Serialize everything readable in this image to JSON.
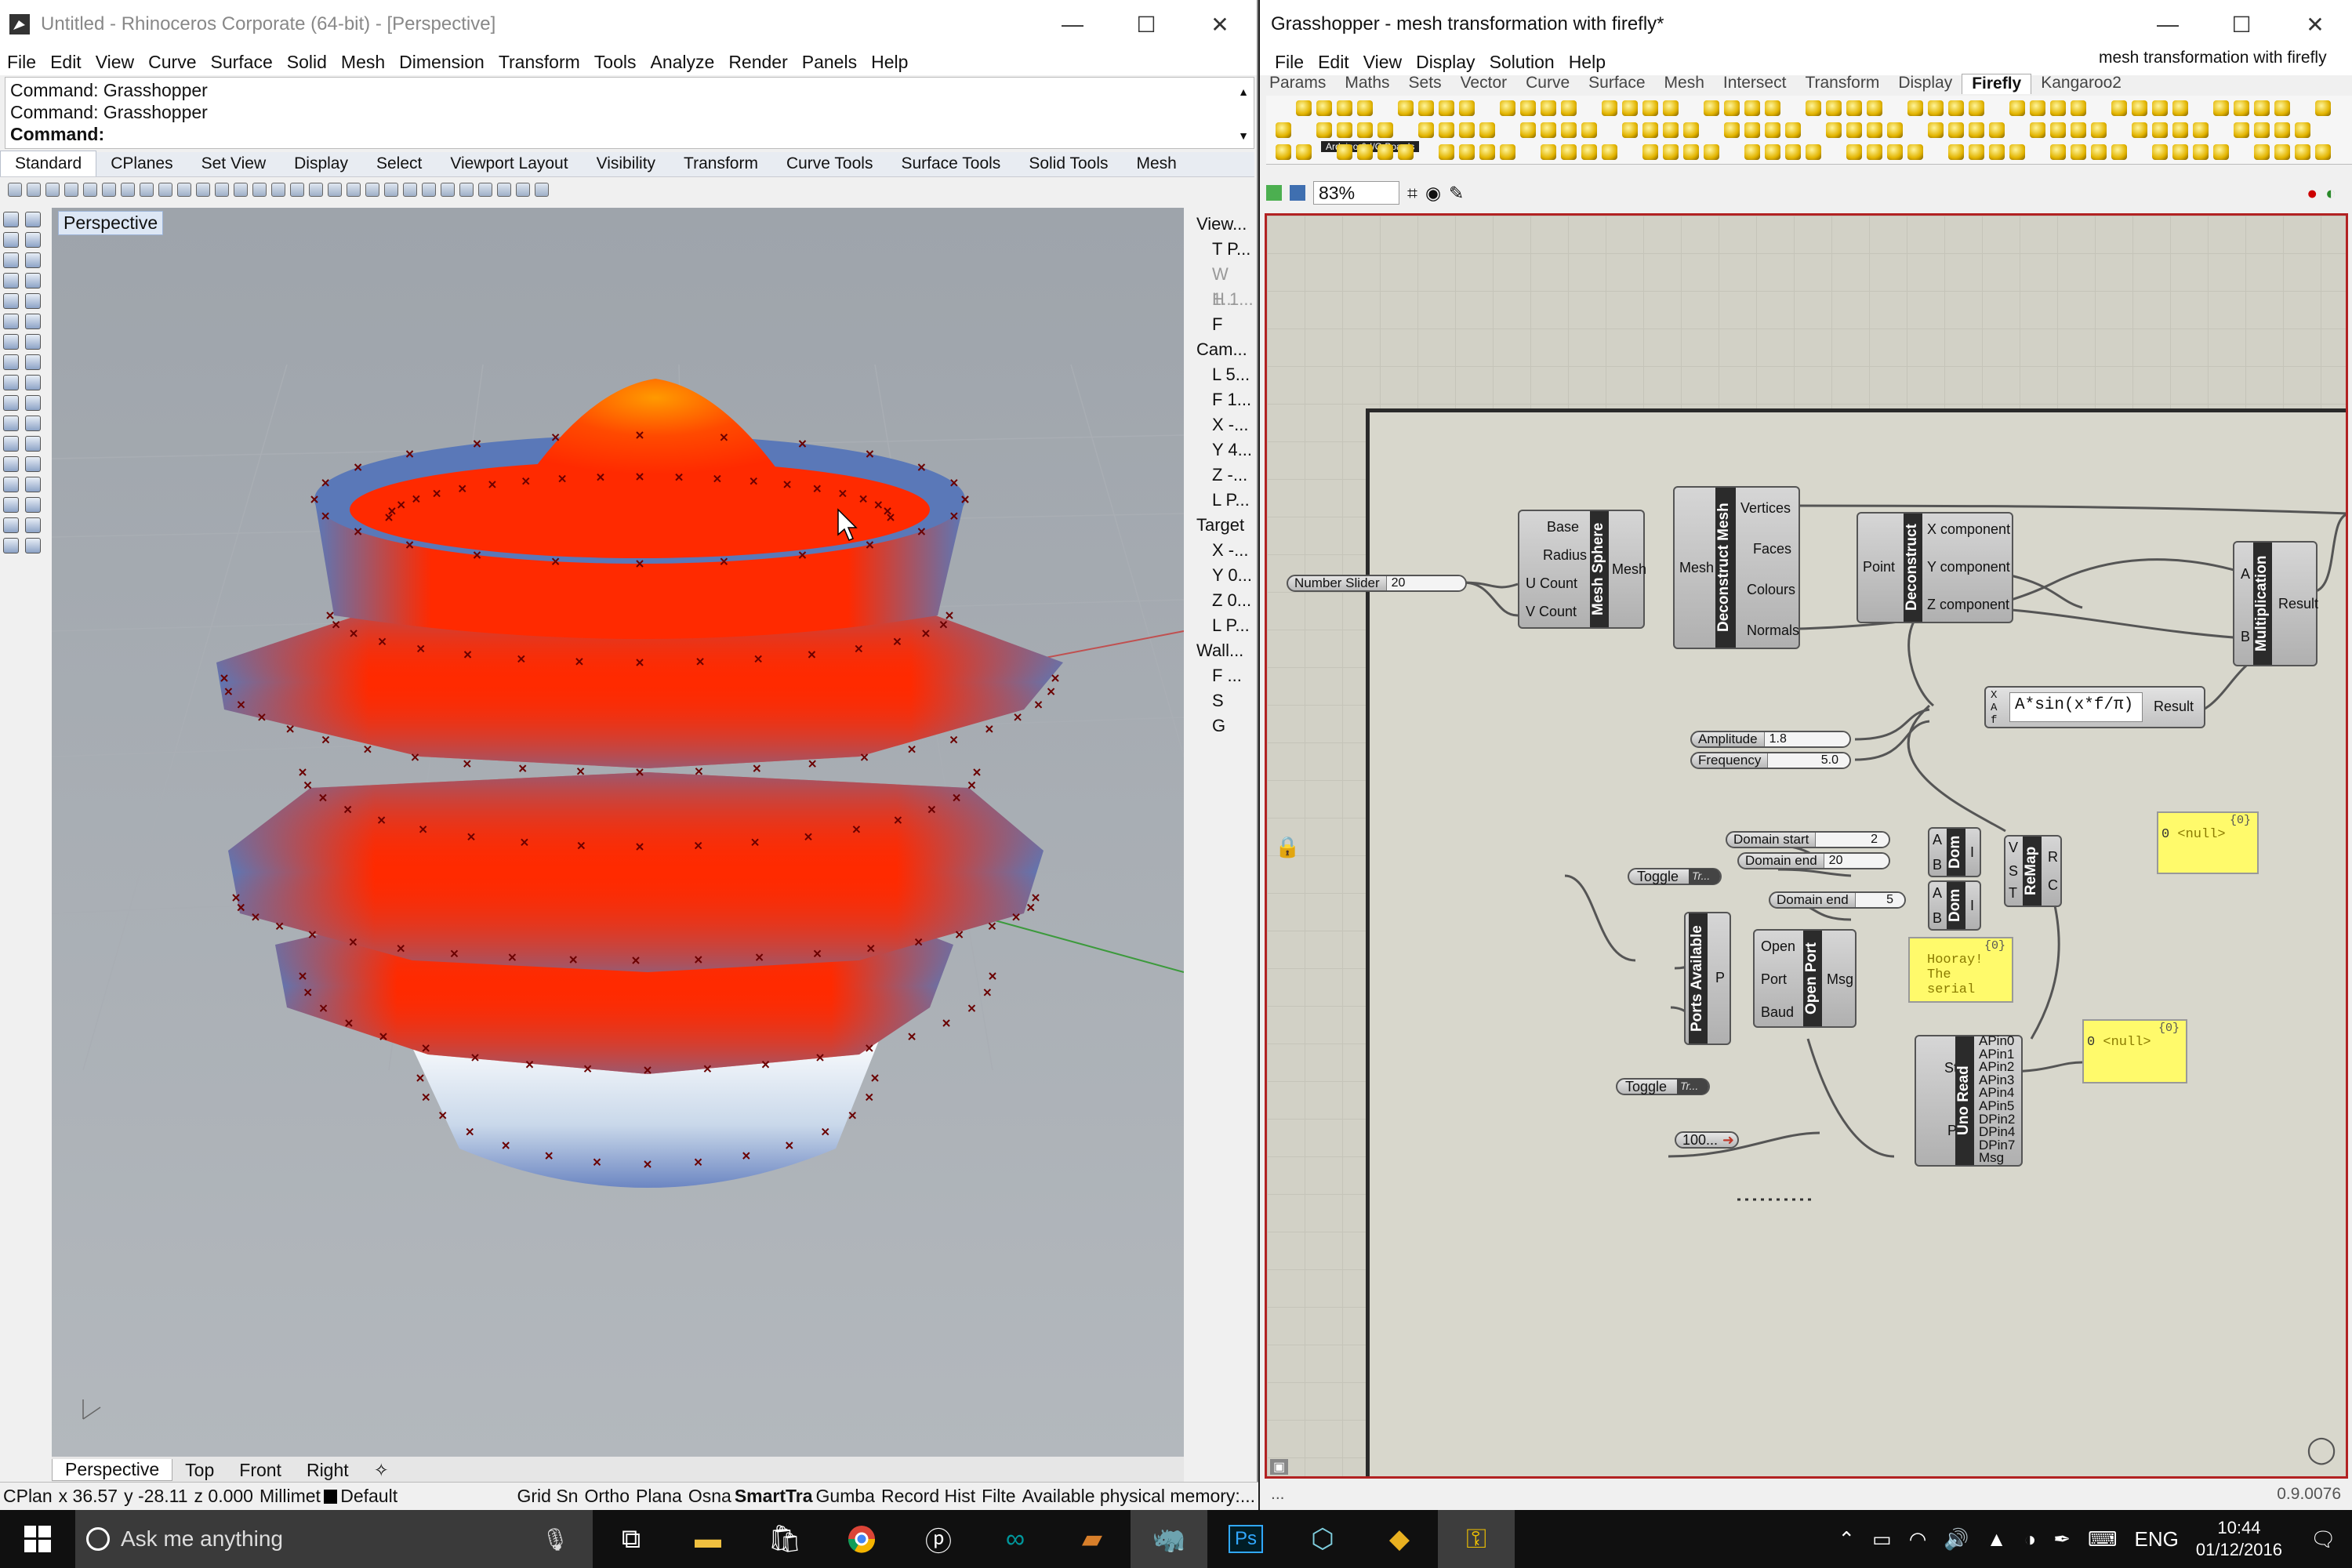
{
  "rhino": {
    "title": "Untitled - Rhinoceros Corporate (64-bit) - [Perspective]",
    "menu": [
      "File",
      "Edit",
      "View",
      "Curve",
      "Surface",
      "Solid",
      "Mesh",
      "Dimension",
      "Transform",
      "Tools",
      "Analyze",
      "Render",
      "Panels",
      "Help"
    ],
    "history": [
      "Command: Grasshopper",
      "Command: Grasshopper"
    ],
    "command_label": "Command:",
    "toolbar_tabs": [
      "Standard",
      "CPlanes",
      "Set View",
      "Display",
      "Select",
      "Viewport Layout",
      "Visibility",
      "Transform",
      "Curve Tools",
      "Surface Tools",
      "Solid Tools",
      "Mesh"
    ],
    "viewport_label": "Perspective",
    "view_tabs": [
      "Perspective",
      "Top",
      "Front",
      "Right"
    ],
    "status": {
      "cplane": "CPlan",
      "x": "x 36.57",
      "y": "y -28.11",
      "z": "z 0.000",
      "units": "Millimet",
      "layer": "Default",
      "toggles": [
        "Grid Sn",
        "Ortho",
        "Plana",
        "Osna",
        "SmartTra",
        "Gumba",
        "Record Hist",
        "Filte"
      ],
      "memory": "Available physical memory:..."
    },
    "properties": {
      "view_header": "View...",
      "view_rows": [
        "T P...",
        "W 1...",
        "H 1...",
        "F"
      ],
      "camera_header": "Cam...",
      "camera_rows": [
        "L 5...",
        "F 1...",
        "X -...",
        "Y 4...",
        "Z -...",
        "L P..."
      ],
      "target_header": "Target",
      "target_rows": [
        "X -...",
        "Y 0...",
        "Z 0...",
        "L P..."
      ],
      "wall_header": "Wall...",
      "wall_rows": [
        "F ...",
        "S",
        "G"
      ]
    }
  },
  "grasshopper": {
    "title": "Grasshopper - mesh transformation with firefly*",
    "menu": [
      "File",
      "Edit",
      "View",
      "Display",
      "Solution",
      "Help"
    ],
    "tabs": [
      "Params",
      "Maths",
      "Sets",
      "Vector",
      "Curve",
      "Surface",
      "Mesh",
      "Intersect",
      "Transform",
      "Display",
      "Firefly",
      "Kangaroo2"
    ],
    "active_tab": "Firefly",
    "doc_name": "mesh transformation with firefly",
    "icon_group_label": "Arduino & I/O Boards",
    "zoom": "83%",
    "version": "0.9.0076",
    "status_left": "...",
    "components": {
      "number_slider": {
        "label": "Number Slider",
        "value": "20"
      },
      "mesh_sphere": {
        "name": "Mesh Sphere",
        "inputs": [
          "Base",
          "Radius",
          "U Count",
          "V Count"
        ],
        "outputs": [
          "Mesh"
        ]
      },
      "deconstruct_mesh": {
        "name": "Deconstruct Mesh",
        "inputs": [
          "Mesh"
        ],
        "outputs": [
          "Vertices",
          "Faces",
          "Colours",
          "Normals"
        ]
      },
      "deconstruct": {
        "name": "Deconstruct",
        "inputs": [
          "Point"
        ],
        "outputs": [
          "X component",
          "Y component",
          "Z component"
        ]
      },
      "multiplication": {
        "name": "Multiplication",
        "inputs": [
          "A",
          "B"
        ],
        "outputs": [
          "Result"
        ]
      },
      "expression": {
        "text": "A*sin(x*f/π)",
        "inputs": [
          "X",
          "A",
          "f"
        ],
        "output": "Result"
      },
      "amplitude": {
        "label": "Amplitude",
        "value": "1.8"
      },
      "frequency": {
        "label": "Frequency",
        "value": "5.0"
      },
      "domain_start": {
        "label": "Domain start",
        "value": "2"
      },
      "domain_end1": {
        "label": "Domain end",
        "value": "20"
      },
      "domain_end2": {
        "label": "Domain end",
        "value": "5"
      },
      "dom1": {
        "name": "Dom",
        "inputs": [
          "A",
          "B"
        ],
        "outputs": [
          "I"
        ]
      },
      "dom2": {
        "name": "Dom",
        "inputs": [
          "A",
          "B"
        ],
        "outputs": [
          "I"
        ]
      },
      "remap": {
        "name": "ReMap",
        "inputs": [
          "V",
          "S",
          "T"
        ],
        "outputs": [
          "R",
          "C"
        ]
      },
      "panel1": {
        "count": "{0}",
        "index": "0",
        "text": "<null>"
      },
      "toggle1": {
        "label": "Toggle",
        "value": "Tr..."
      },
      "ports_available": {
        "name": "Ports Available",
        "outputs": [
          "P"
        ]
      },
      "open_port": {
        "name": "Open Port",
        "inputs": [
          "Open",
          "Port",
          "Baud"
        ],
        "outputs": [
          "Msg"
        ]
      },
      "panel2": {
        "count": "{0}",
        "lines": [
          "Hooray!",
          "The",
          "serial"
        ]
      },
      "uno_read": {
        "name": "Uno Read",
        "inputs": [
          "Start",
          "Port"
        ],
        "outputs": [
          "APin0",
          "APin1",
          "APin2",
          "APin3",
          "APin4",
          "APin5",
          "DPin2",
          "DPin4",
          "DPin7",
          "Msg"
        ]
      },
      "panel3": {
        "count": "{0}",
        "index": "0",
        "text": "<null>"
      },
      "toggle2": {
        "label": "Toggle",
        "value": "Tr..."
      },
      "timer": {
        "label": "100..."
      }
    }
  },
  "taskbar": {
    "search_placeholder": "Ask me anything",
    "apps": [
      "task-view",
      "file-explorer",
      "store",
      "chrome",
      "pinterest",
      "arduino",
      "slate",
      "rhino",
      "photoshop",
      "hexagon",
      "gem",
      "grasshopper-key"
    ],
    "language": "ENG",
    "time": "10:44",
    "date": "01/12/2016"
  },
  "colors": {
    "hot": "#ff2a00",
    "cool": "#5a78b8",
    "canvas": "#d2d1c6",
    "panel": "#fffa6b"
  }
}
